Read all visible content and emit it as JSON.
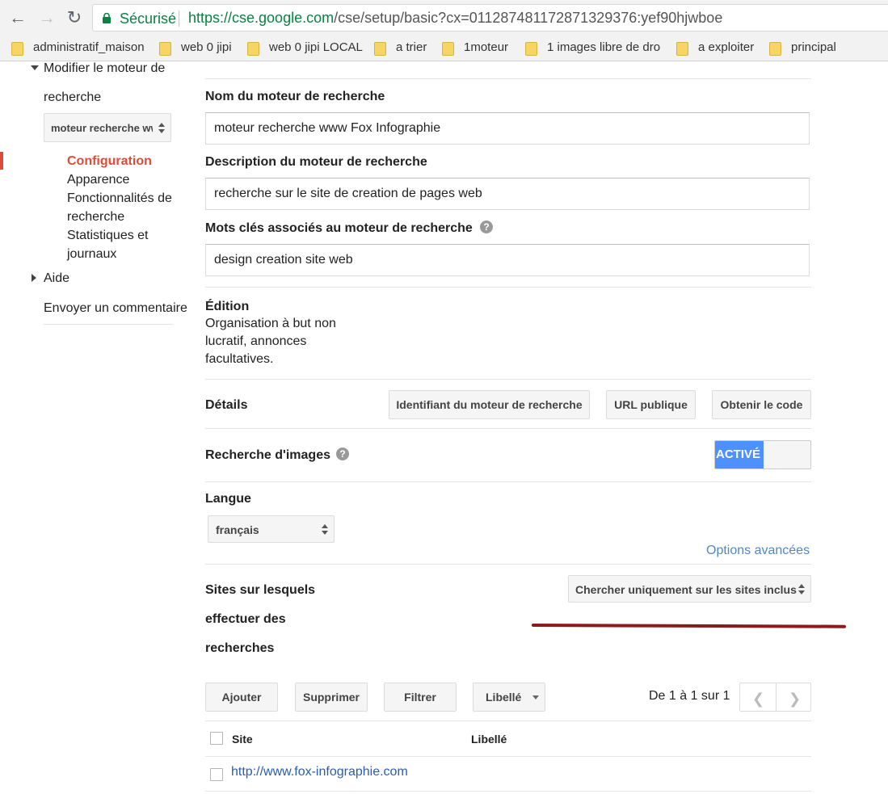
{
  "browser": {
    "secure_label": "Sécurisé",
    "url_host": "https://cse.google.com",
    "url_path": "/cse/setup/basic?cx=011287481172871329376:yef90hjwboe",
    "bookmarks": [
      {
        "label": "administratif_maison"
      },
      {
        "label": "web 0 jipi"
      },
      {
        "label": "web 0 jipi LOCAL"
      },
      {
        "label": "a trier"
      },
      {
        "label": "1moteur"
      },
      {
        "label": "1 images libre de dro"
      },
      {
        "label": "a exploiter"
      },
      {
        "label": "principal"
      }
    ]
  },
  "sidebar": {
    "section_line1": "Modifier le moteur de",
    "section_line2": "recherche",
    "engine_select": "moteur recherche www Fox Infographie",
    "sub_items": {
      "configuration": "Configuration",
      "apparence": "Apparence",
      "fonctionnalites_1": "Fonctionnalités de",
      "fonctionnalites_2": "recherche",
      "statistiques_1": "Statistiques et",
      "statistiques_2": "journaux"
    },
    "aide": "Aide",
    "feedback": "Envoyer un commentaire"
  },
  "form": {
    "name_label": "Nom du moteur de recherche",
    "name_value": "moteur recherche www Fox Infographie",
    "description_label": "Description du moteur de recherche",
    "description_value": "recherche sur le site de creation de pages web",
    "keywords_label": "Mots clés associés au moteur de recherche",
    "keywords_value": "design creation site web",
    "edition_label": "Édition",
    "edition_line1": "Organisation à but non",
    "edition_line2": "lucratif, annonces",
    "edition_line3": "facultatives.",
    "details_label": "Détails",
    "details_buttons": {
      "engine_id": "Identifiant du moteur de recherche",
      "public_url": "URL publique",
      "get_code": "Obtenir le code"
    },
    "image_search_label": "Recherche d'images",
    "image_search_toggle": "ACTIVÉ",
    "language_label": "Langue",
    "language_value": "français",
    "advanced_options": "Options avancées",
    "sites_label_1": "Sites sur lesquels",
    "sites_label_2": "effectuer des",
    "sites_label_3": "recherches",
    "sites_mode": "Chercher uniquement sur les sites inclus"
  },
  "sites_table": {
    "buttons": {
      "add": "Ajouter",
      "delete": "Supprimer",
      "filter": "Filtrer",
      "label": "Libellé"
    },
    "pagination": "De 1 à 1 sur 1",
    "columns": {
      "site": "Site",
      "label": "Libellé"
    },
    "rows": [
      {
        "site": "http://www.fox-infographie.com",
        "label": ""
      }
    ]
  },
  "colors": {
    "secure_green": "#0b8043",
    "active_red": "#dd4b39",
    "toggle_blue": "#4d90fe",
    "link_blue": "#2a5db0",
    "annotation_red": "#8b1a1a"
  }
}
